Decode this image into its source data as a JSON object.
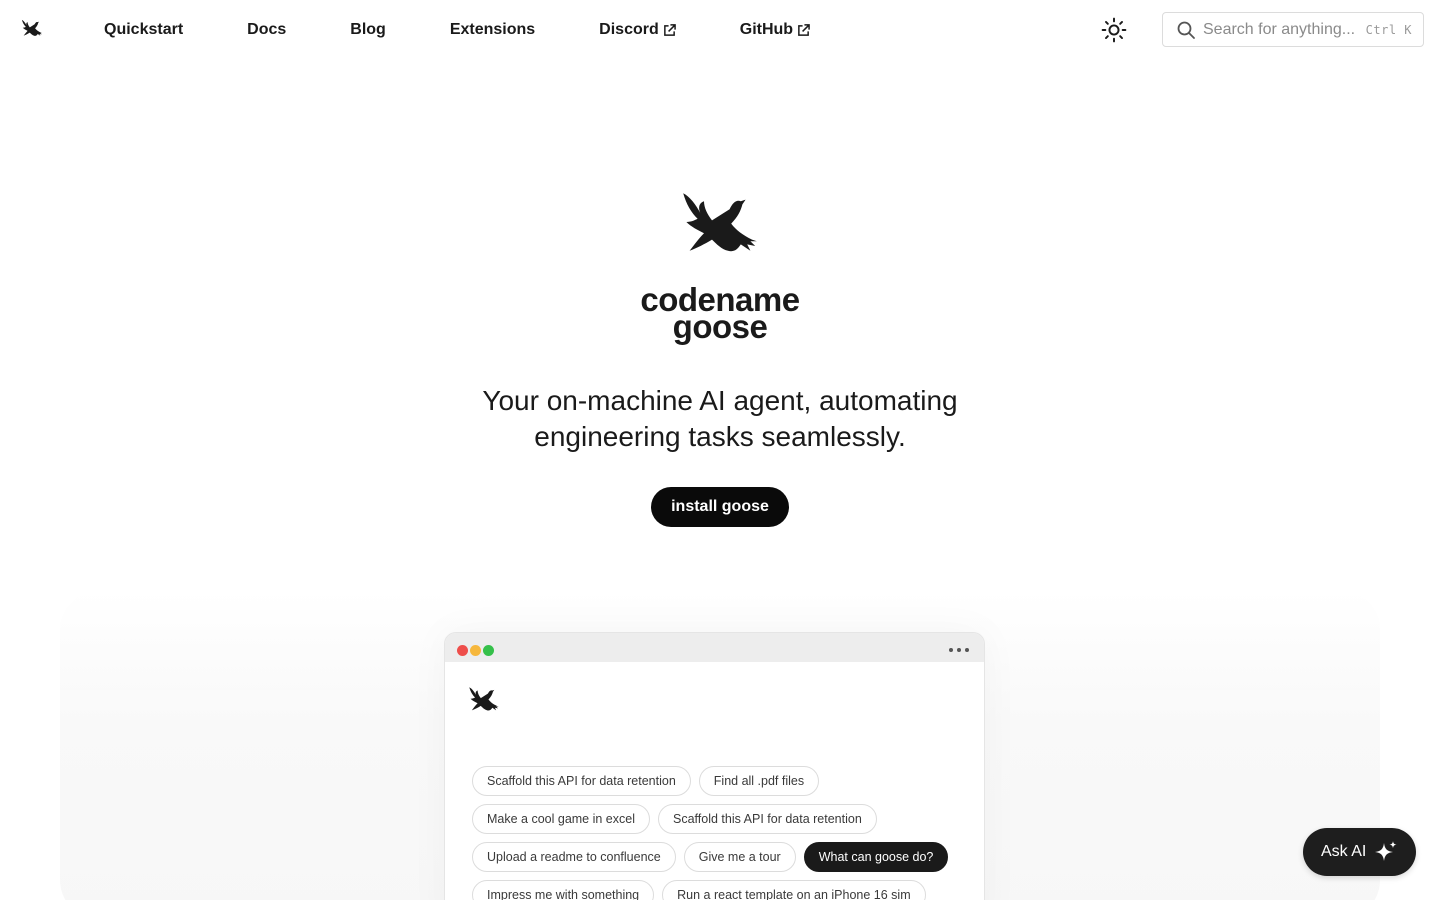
{
  "nav": {
    "links": [
      {
        "label": "Quickstart",
        "external": false
      },
      {
        "label": "Docs",
        "external": false
      },
      {
        "label": "Blog",
        "external": false
      },
      {
        "label": "Extensions",
        "external": false
      },
      {
        "label": "Discord",
        "external": true
      },
      {
        "label": "GitHub",
        "external": true
      }
    ],
    "theme_icon": "sun-icon",
    "search": {
      "placeholder": "Search for anything...",
      "shortcut": "Ctrl K"
    }
  },
  "hero": {
    "title_line1": "codename",
    "title_line2": "goose",
    "subtitle": "Your on-machine AI agent, automating engineering tasks seamlessly.",
    "cta_label": "install goose"
  },
  "demo": {
    "chip_rows": [
      [
        {
          "label": "Scaffold this API for data retention",
          "active": false
        },
        {
          "label": "Find all .pdf files",
          "active": false
        }
      ],
      [
        {
          "label": "Make a cool game in excel",
          "active": false
        },
        {
          "label": "Scaffold this API for data retention",
          "active": false
        }
      ],
      [
        {
          "label": "Upload a readme to confluence",
          "active": false
        },
        {
          "label": "Give me a tour",
          "active": false
        },
        {
          "label": "What can goose do?",
          "active": true
        }
      ],
      [
        {
          "label": "Impress me with something",
          "active": false
        },
        {
          "label": "Run a react template on an iPhone 16 sim",
          "active": false
        }
      ]
    ]
  },
  "ask_ai": {
    "label": "Ask AI"
  },
  "colors": {
    "text": "#1a1a1a",
    "button_bg": "#0a0a0a",
    "dot_red": "#ee4e4b",
    "dot_yellow": "#f6b73c",
    "dot_green": "#35c04a"
  }
}
